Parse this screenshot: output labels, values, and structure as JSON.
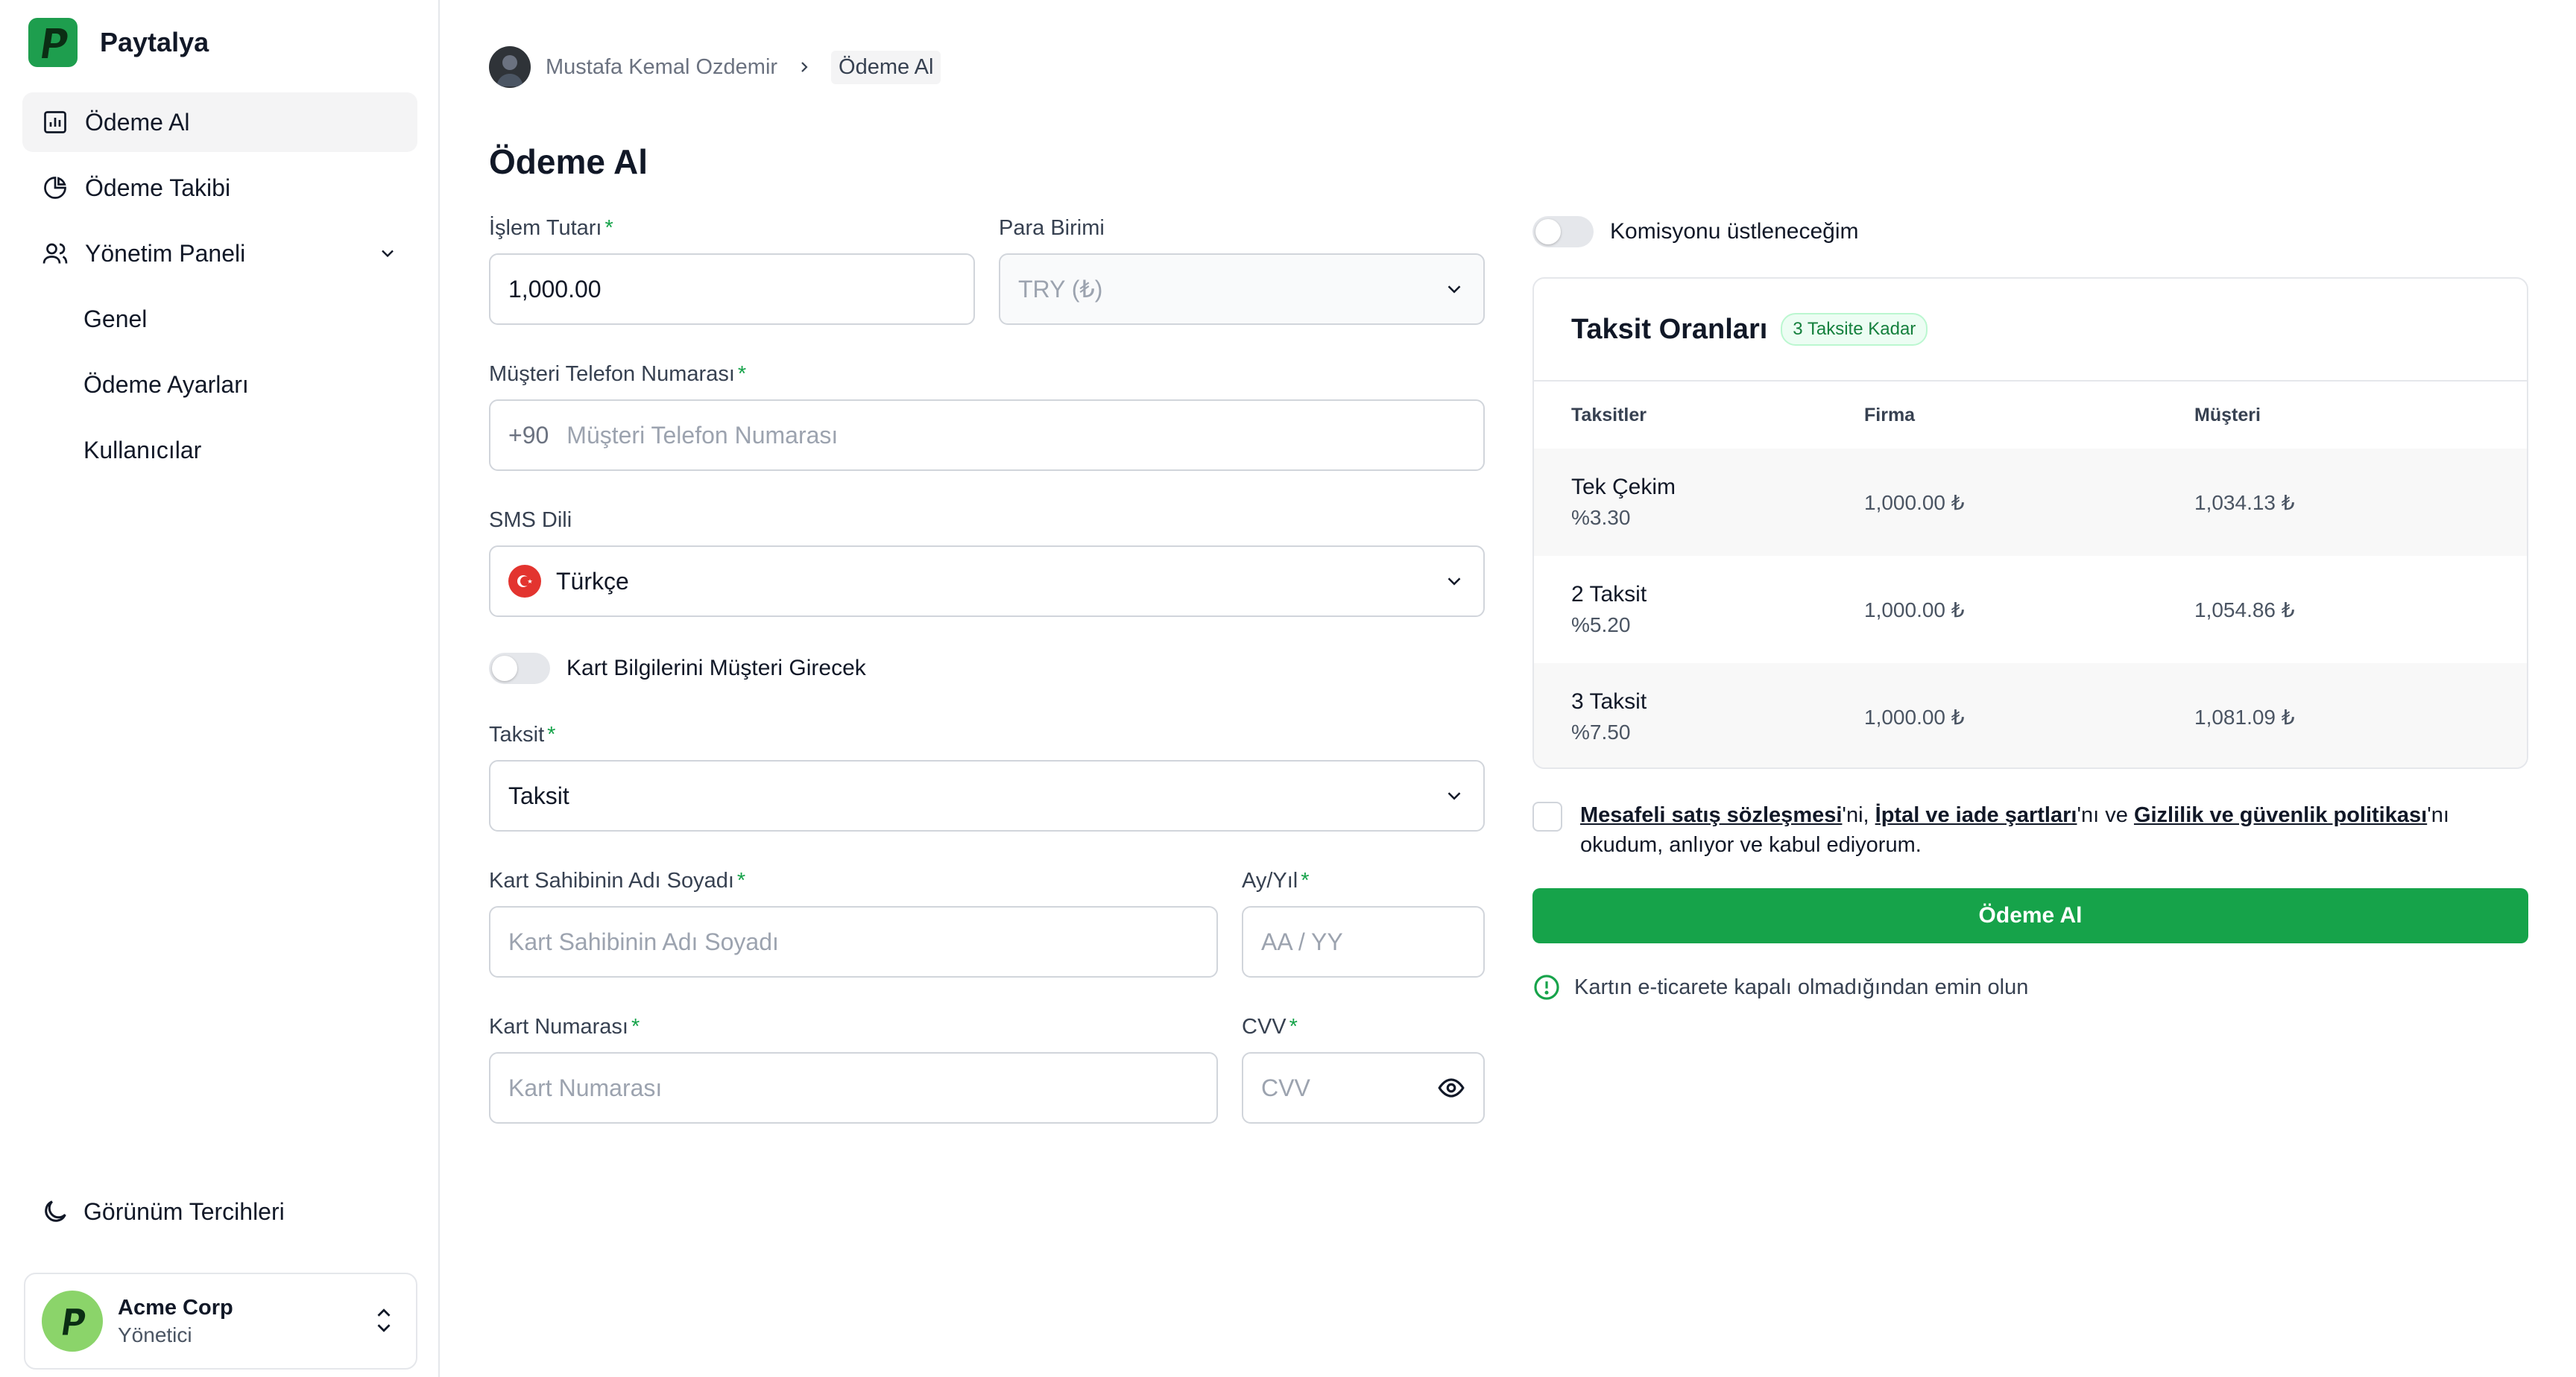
{
  "brand": {
    "name": "Paytalya"
  },
  "sidebar": {
    "items": [
      {
        "label": "Ödeme Al"
      },
      {
        "label": "Ödeme Takibi"
      },
      {
        "label": "Yönetim Paneli"
      },
      {
        "label": "Genel"
      },
      {
        "label": "Ödeme Ayarları"
      },
      {
        "label": "Kullanıcılar"
      }
    ],
    "appearance_label": "Görünüm Tercihleri",
    "account": {
      "name": "Acme Corp",
      "role": "Yönetici"
    }
  },
  "breadcrumb": {
    "user": "Mustafa Kemal Ozdemir",
    "current": "Ödeme Al"
  },
  "page": {
    "title": "Ödeme Al"
  },
  "form": {
    "amount": {
      "label": "İşlem Tutarı",
      "value": "1,000.00"
    },
    "currency": {
      "label": "Para Birimi",
      "value": "TRY (₺)"
    },
    "phone": {
      "label": "Müşteri Telefon Numarası",
      "prefix": "+90",
      "placeholder": "Müşteri Telefon Numarası"
    },
    "sms_language": {
      "label": "SMS Dili",
      "value": "Türkçe"
    },
    "card_by_customer": {
      "label": "Kart Bilgilerini Müşteri Girecek",
      "on": false
    },
    "installment": {
      "label": "Taksit",
      "value": "Taksit"
    },
    "card_holder": {
      "label": "Kart Sahibinin Adı Soyadı",
      "placeholder": "Kart Sahibinin Adı Soyadı"
    },
    "expiry": {
      "label": "Ay/Yıl",
      "placeholder": "AA / YY"
    },
    "card_number": {
      "label": "Kart Numarası",
      "placeholder": "Kart Numarası"
    },
    "cvv": {
      "label": "CVV",
      "placeholder": "CVV"
    },
    "required_mark": "*"
  },
  "commission": {
    "label": "Komisyonu üstleneceğim",
    "on": false
  },
  "rates": {
    "title": "Taksit Oranları",
    "badge": "3 Taksite Kadar",
    "headers": [
      "Taksitler",
      "Firma",
      "Müşteri"
    ],
    "rows": [
      {
        "name": "Tek Çekim",
        "rate": "%3.30",
        "company": "1,000.00 ₺",
        "customer": "1,034.13 ₺"
      },
      {
        "name": "2 Taksit",
        "rate": "%5.20",
        "company": "1,000.00 ₺",
        "customer": "1,054.86 ₺"
      },
      {
        "name": "3 Taksit",
        "rate": "%7.50",
        "company": "1,000.00 ₺",
        "customer": "1,081.09 ₺"
      }
    ]
  },
  "agreement": {
    "link1": "Mesafeli satış sözleşmesi",
    "sep1": "'ni, ",
    "link2": "İptal ve iade şartları",
    "sep2": "'nı ve ",
    "link3": "Gizlilik ve güvenlik politikası",
    "tail": "'nı okudum, anlıyor ve kabul ediyorum."
  },
  "pay_button": "Ödeme Al",
  "notice": "Kartın e-ticarete kapalı olmadığından emin olun",
  "colors": {
    "accent": "#16a34a",
    "brand": "#1e9e4e",
    "flag": "#e3342f"
  }
}
